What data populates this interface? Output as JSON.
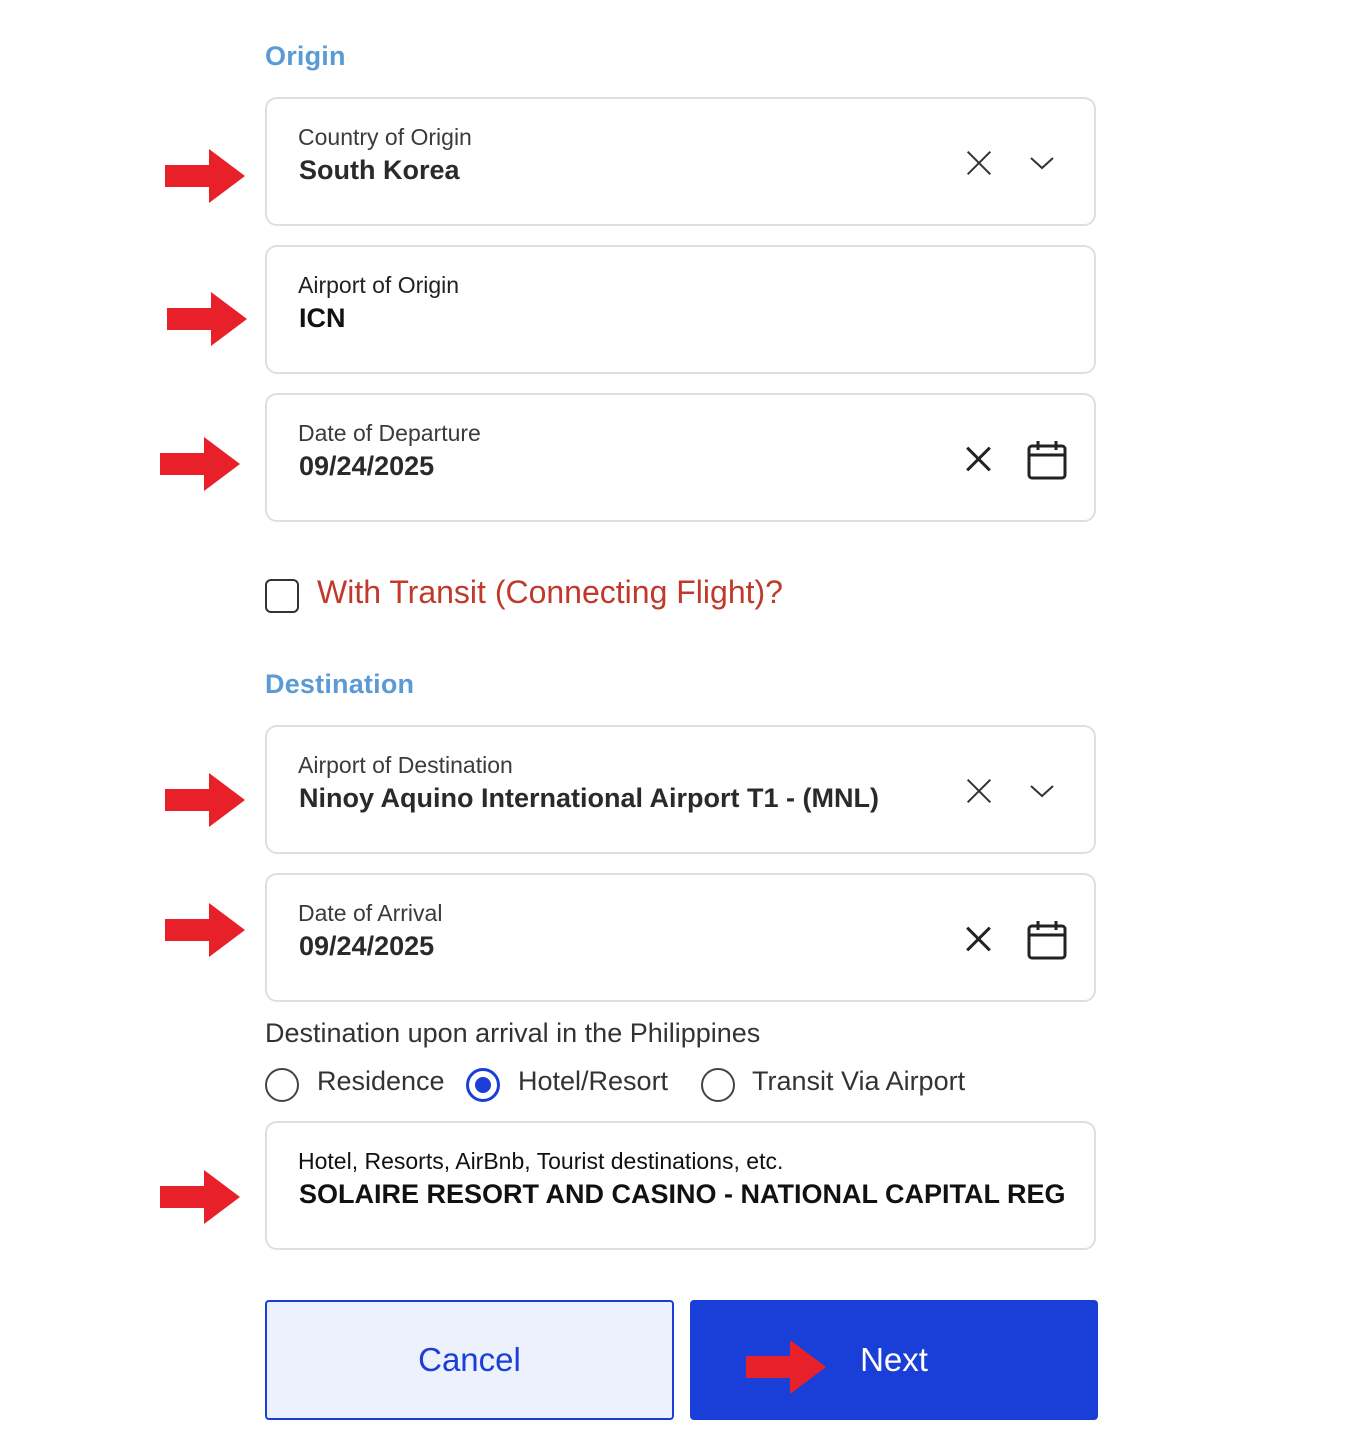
{
  "origin": {
    "section_title": "Origin",
    "country": {
      "label": "Country of Origin",
      "value": "South Korea"
    },
    "airport": {
      "label": "Airport of Origin",
      "value": "ICN"
    },
    "departure": {
      "label": "Date of Departure",
      "value": "09/24/2025"
    }
  },
  "transit": {
    "label": "With Transit (Connecting Flight)?",
    "checked": false
  },
  "destination": {
    "section_title": "Destination",
    "airport": {
      "label": "Airport of Destination",
      "value": "Ninoy Aquino International Airport T1 - (MNL)"
    },
    "arrival": {
      "label": "Date of Arrival",
      "value": "09/24/2025"
    },
    "upon_arrival_question": "Destination upon arrival in the Philippines",
    "options": [
      {
        "label": "Residence",
        "selected": false
      },
      {
        "label": "Hotel/Resort",
        "selected": true
      },
      {
        "label": "Transit Via Airport",
        "selected": false
      }
    ],
    "hotel": {
      "label": "Hotel, Resorts, AirBnb, Tourist destinations, etc.",
      "value": "SOLAIRE RESORT AND CASINO - NATIONAL CAPITAL REGION"
    }
  },
  "buttons": {
    "cancel": "Cancel",
    "next": "Next"
  },
  "colors": {
    "accent": "#1a3fd8",
    "section_title": "#5b9bd5",
    "transit_text": "#c0392b",
    "annotation_arrow": "#e8202a"
  },
  "icons": {
    "clear": "close-icon",
    "dropdown": "chevron-down-icon",
    "date": "calendar-icon",
    "annotation": "red-arrow-icon"
  }
}
